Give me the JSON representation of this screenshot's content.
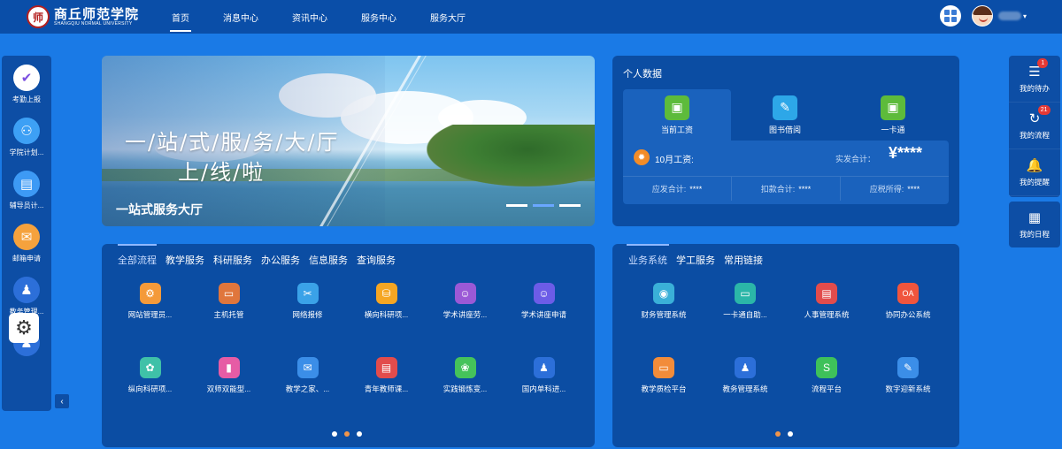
{
  "header": {
    "logo_cn": "商丘师范学院",
    "logo_en": "SHANGQIU NORMAL UNIVERSITY",
    "logo_mark": "师",
    "nav": [
      "首页",
      "消息中心",
      "资讯中心",
      "服务中心",
      "服务大厅"
    ]
  },
  "left_sidebar": [
    {
      "label": "考勤上报",
      "icon": "check-icon",
      "color": "#ffffff",
      "glyph": "✔"
    },
    {
      "label": "学院计划...",
      "icon": "org-icon",
      "color": "#3da0f5",
      "glyph": "⚇"
    },
    {
      "label": "辅导员计...",
      "icon": "clipboard-icon",
      "color": "#3d9af5",
      "glyph": "▤"
    },
    {
      "label": "邮箱申请",
      "icon": "mail-icon",
      "color": "#f5a23d",
      "glyph": "✉"
    },
    {
      "label": "教务管理...",
      "icon": "teacher-icon",
      "color": "#2c6fd9",
      "glyph": "♟"
    },
    {
      "label": "",
      "icon": "teacher-icon",
      "color": "#2c6fd9",
      "glyph": "♟"
    }
  ],
  "banner": {
    "title_line1": "一/站/式/服/务/大/厅",
    "title_line2": "上/线/啦",
    "caption": "一站式服务大厅"
  },
  "personal": {
    "title": "个人数据",
    "tabs": [
      {
        "label": "当前工资",
        "icon": "bus-icon",
        "color": "#5dbb3b",
        "glyph": "▣"
      },
      {
        "label": "图书借阅",
        "icon": "reading-icon",
        "color": "#2da7e8",
        "glyph": "✎"
      },
      {
        "label": "一卡通",
        "icon": "bus-icon",
        "color": "#5dbb3b",
        "glyph": "▣"
      }
    ],
    "month": "10月工资:",
    "net_label": "实发合计：",
    "net_value": "¥****",
    "rows": [
      {
        "label": "应发合计:",
        "value": "****"
      },
      {
        "label": "扣款合计:",
        "value": "****"
      },
      {
        "label": "应税所得:",
        "value": "****"
      }
    ]
  },
  "right_sidebar": [
    {
      "label": "我的待办",
      "icon": "todo-icon",
      "glyph": "☰",
      "badge": "1"
    },
    {
      "label": "我的流程",
      "icon": "flow-icon",
      "glyph": "↻",
      "badge": "21"
    },
    {
      "label": "我的提醒",
      "icon": "bell-icon",
      "glyph": "🔔",
      "badge": ""
    },
    {
      "label": "我的日程",
      "icon": "calendar-icon",
      "glyph": "▦",
      "badge": ""
    }
  ],
  "services": {
    "tabs": [
      "全部流程",
      "教学服务",
      "科研服务",
      "办公服务",
      "信息服务",
      "查询服务"
    ],
    "items": [
      {
        "label": "网站管理员...",
        "color": "#f49a3a",
        "glyph": "⚙"
      },
      {
        "label": "主机托管",
        "color": "#e0763c",
        "glyph": "▭"
      },
      {
        "label": "网络报修",
        "color": "#3aa2e8",
        "glyph": "✂"
      },
      {
        "label": "横向科研项...",
        "color": "#f5a623",
        "glyph": "⛁"
      },
      {
        "label": "学术讲座劳...",
        "color": "#9b59d6",
        "glyph": "☺"
      },
      {
        "label": "学术讲座申请",
        "color": "#6c5ce7",
        "glyph": "☺"
      },
      {
        "label": "纵向科研项...",
        "color": "#3fc1a8",
        "glyph": "✿"
      },
      {
        "label": "双师双能型...",
        "color": "#e65ca5",
        "glyph": "▮"
      },
      {
        "label": "教学之家、...",
        "color": "#3b8ee8",
        "glyph": "✉"
      },
      {
        "label": "青年教师课...",
        "color": "#e24c4c",
        "glyph": "▤"
      },
      {
        "label": "实践锻炼变...",
        "color": "#45c35a",
        "glyph": "❀"
      },
      {
        "label": "国内单科进...",
        "color": "#2c6fd9",
        "glyph": "♟"
      }
    ]
  },
  "links": {
    "tabs": [
      "业务系统",
      "学工服务",
      "常用链接"
    ],
    "items": [
      {
        "label": "财务管理系统",
        "color": "#3ab0d8",
        "glyph": "◉"
      },
      {
        "label": "一卡通自助...",
        "color": "#2bb6a8",
        "glyph": "▭"
      },
      {
        "label": "人事管理系统",
        "color": "#e24c4c",
        "glyph": "▤"
      },
      {
        "label": "协同办公系统",
        "color": "#f0553d",
        "glyph": "OA"
      },
      {
        "label": "教学质检平台",
        "color": "#f28c3a",
        "glyph": "▭"
      },
      {
        "label": "教务管理系统",
        "color": "#2c6fd9",
        "glyph": "♟"
      },
      {
        "label": "流程平台",
        "color": "#3ec15a",
        "glyph": "S"
      },
      {
        "label": "数字迎新系统",
        "color": "#3b8ee8",
        "glyph": "✎"
      }
    ]
  },
  "collapse_glyph": "‹"
}
